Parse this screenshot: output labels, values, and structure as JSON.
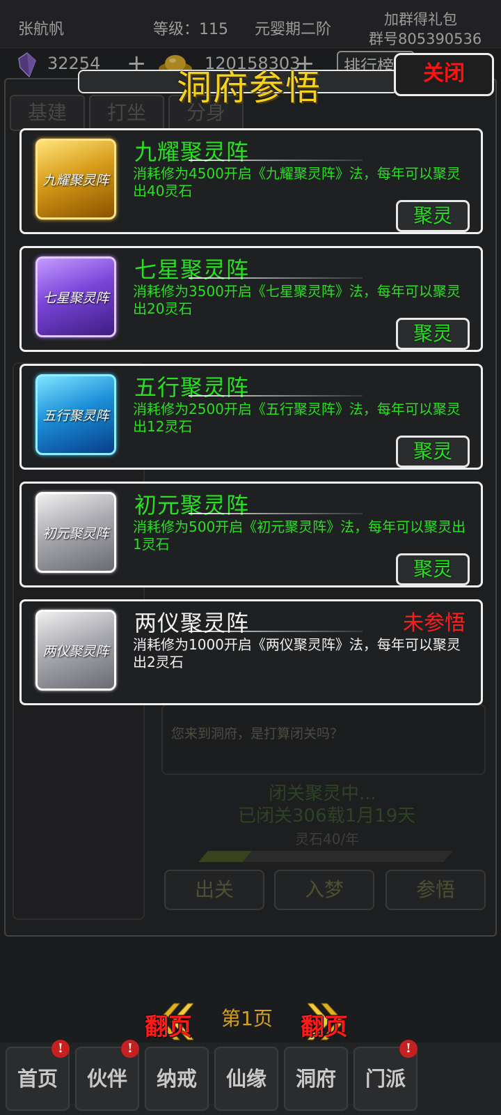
{
  "header": {
    "player_name": "张航帆",
    "level": "等级：115",
    "realm": "元婴期二阶",
    "group_gift": "加群得礼包",
    "group_id": "群号805390536"
  },
  "resources": {
    "gems": "32254",
    "gold": "120158303",
    "plus_label": "+",
    "rank_label": "排行榜"
  },
  "background": {
    "tabs": [
      "基建",
      "打坐",
      "分身"
    ],
    "message": "您来到洞府，是打算闭关吗？",
    "status_line1": "闭关聚灵中...",
    "status_line2": "已闭关306载1月19天",
    "income": "灵石40/年",
    "progress": 0.18,
    "buttons": [
      "出关",
      "入梦",
      "参悟"
    ]
  },
  "modal": {
    "title": "洞府参悟",
    "close_label": "关闭",
    "formations": [
      {
        "name": "九耀聚灵阵",
        "icon_label": "九耀聚灵阵",
        "icon_color": "gold",
        "description": "消耗修为4500开启《九耀聚灵阵》法，每年可以聚灵出40灵石",
        "action_label": "聚灵",
        "learned": true
      },
      {
        "name": "七星聚灵阵",
        "icon_label": "七星聚灵阵",
        "icon_color": "purple",
        "description": "消耗修为3500开启《七星聚灵阵》法，每年可以聚灵出20灵石",
        "action_label": "聚灵",
        "learned": true
      },
      {
        "name": "五行聚灵阵",
        "icon_label": "五行聚灵阵",
        "icon_color": "blue",
        "description": "消耗修为2500开启《五行聚灵阵》法，每年可以聚灵出12灵石",
        "action_label": "聚灵",
        "learned": true
      },
      {
        "name": "初元聚灵阵",
        "icon_label": "初元聚灵阵",
        "icon_color": "gray",
        "description": "消耗修为500开启《初元聚灵阵》法，每年可以聚灵出1灵石",
        "action_label": "聚灵",
        "learned": true
      },
      {
        "name": "两仪聚灵阵",
        "icon_label": "两仪聚灵阵",
        "icon_color": "gray",
        "description": "消耗修为1000开启《两仪聚灵阵》法，每年可以聚灵出2灵石",
        "status_label": "未参悟",
        "learned": false
      }
    ],
    "pager": {
      "prev_label": "翻页",
      "next_label": "翻页",
      "page_label": "第1页"
    }
  },
  "nav": {
    "items": [
      "首页",
      "伙伴",
      "纳戒",
      "仙缘",
      "洞府",
      "门派"
    ],
    "alert_symbol": "!"
  },
  "colors": {
    "title_gold": "#f5d21a",
    "text_green": "#27e01f",
    "alert_red": "#ff1d1d"
  }
}
